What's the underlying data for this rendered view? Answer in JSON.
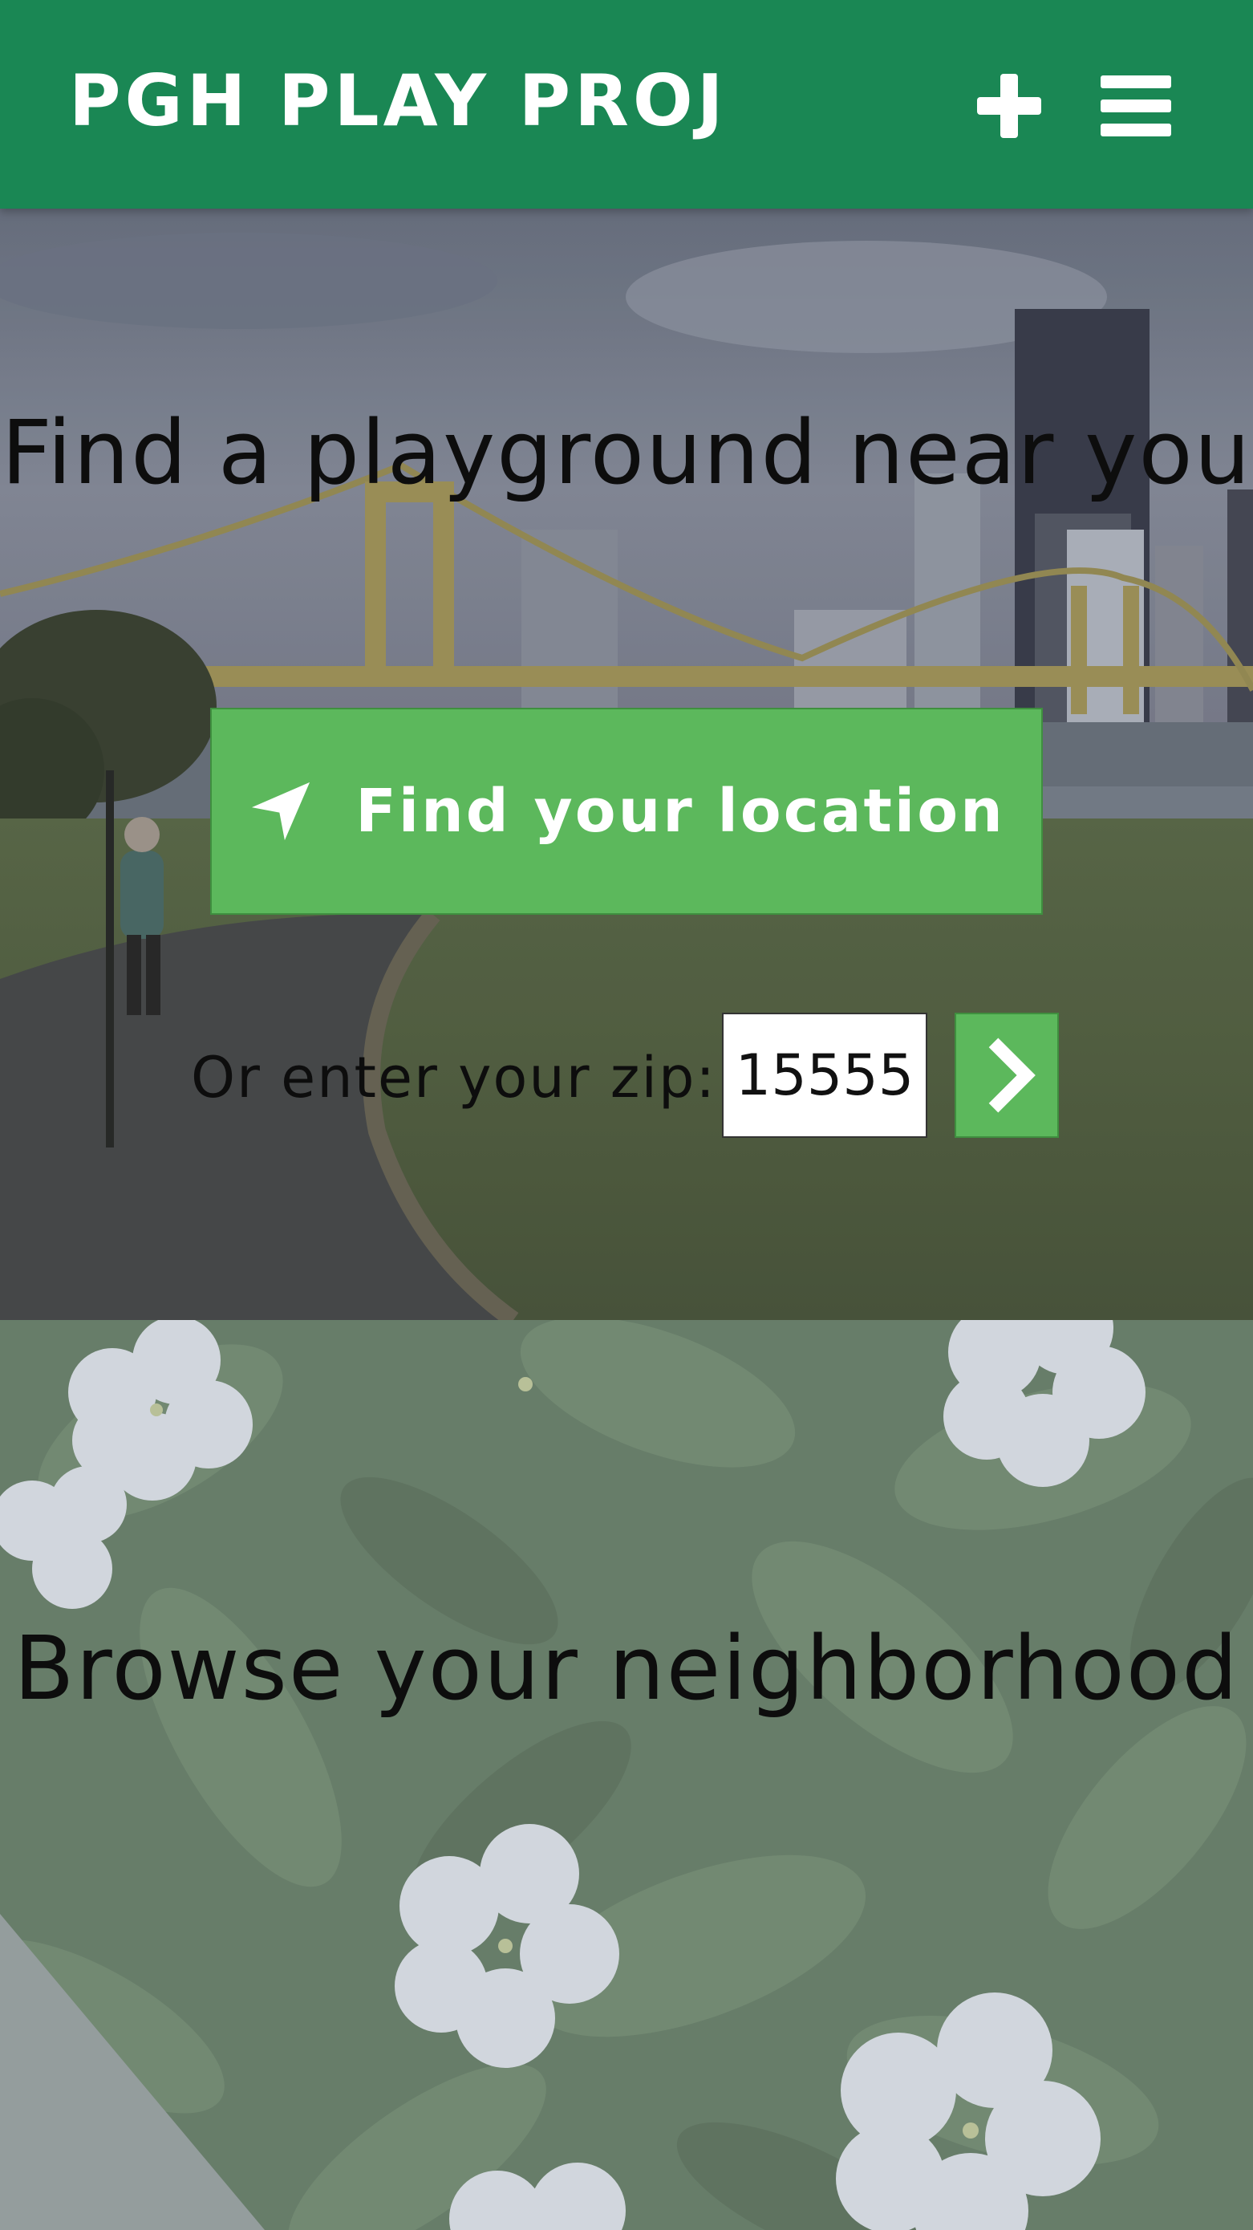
{
  "header": {
    "brand": "PGH PLAY PROJ",
    "add_icon": "plus-icon",
    "menu_icon": "hamburger-menu-icon",
    "background_color": "#1a8754"
  },
  "hero": {
    "title": "Find a playground near you",
    "locate_button": {
      "label": "Find your location",
      "icon": "location-arrow-icon",
      "color": "#5cb85c"
    },
    "zip": {
      "label": "Or enter your zip:",
      "value": "15555",
      "submit_icon": "chevron-right-icon"
    },
    "background_image": "pittsburgh-bridge-skyline-photo"
  },
  "browse": {
    "title": "Browse your neighborhood",
    "background_image": "white-periwinkle-flowers-photo"
  }
}
